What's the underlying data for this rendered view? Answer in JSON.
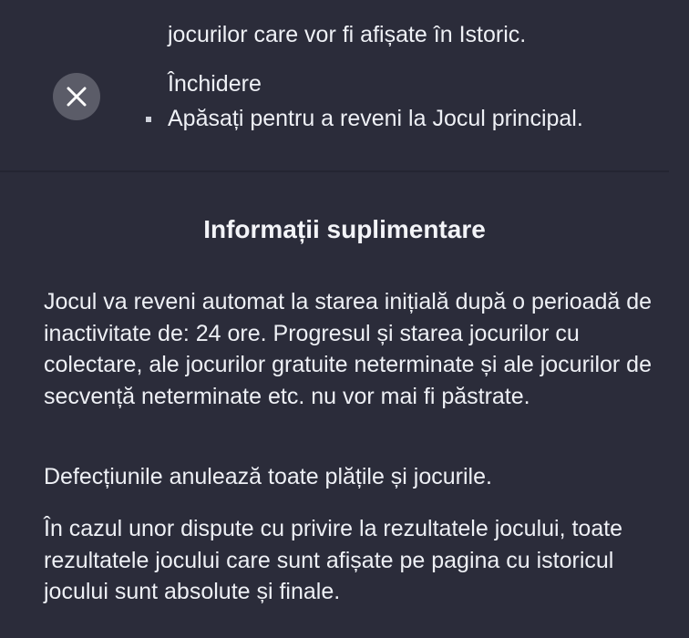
{
  "history_section": {
    "last_line": "jocurilor care vor fi afișate în Istoric."
  },
  "close_item": {
    "title": "Închidere",
    "description": "Apăsați pentru a reveni la Jocul principal.",
    "icon": "close-icon"
  },
  "additional_info": {
    "title": "Informații suplimentare",
    "paragraphs": [
      "Jocul va reveni automat la starea inițială după o perioadă de inactivitate de: 24 ore. Progresul și starea jocurilor cu colectare, ale jocurilor gratuite neterminate și ale jocurilor de secvență neterminate etc. nu vor mai fi păstrate.",
      "Defecțiunile anulează toate plățile și jocurile.",
      "În cazul unor dispute cu privire la rezultatele jocului, toate rezultatele jocului care sunt afișate pe pagina cu istoricul jocului sunt absolute și finale."
    ]
  },
  "colors": {
    "background": "#2b2c3a",
    "text": "#eef0f5",
    "close_button": "#5b5c68"
  }
}
